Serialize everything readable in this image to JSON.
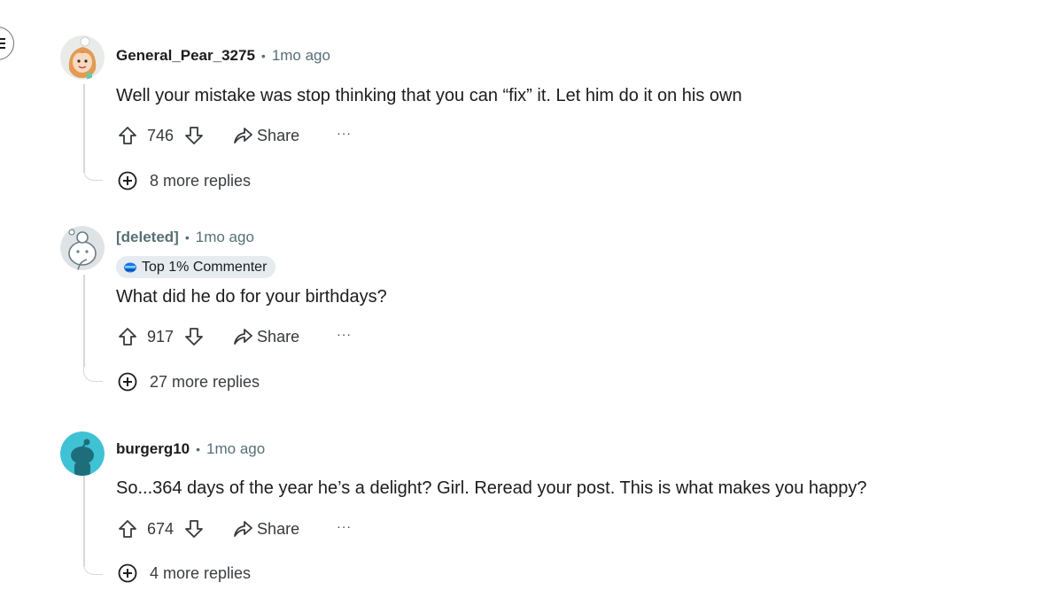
{
  "comments": [
    {
      "username": "General_Pear_3275",
      "time": "1mo ago",
      "text": "Well your mistake was stop thinking that you can “fix” it. Let him do it on his own",
      "score": "746",
      "share_label": "Share",
      "more_replies": "8 more replies",
      "avatar_icon": "snoo-avatar-girl-icon"
    },
    {
      "username": "[deleted]",
      "time": "1mo ago",
      "badge": "Top 1% Commenter",
      "text": "What did he do for your birthdays?",
      "score": "917",
      "share_label": "Share",
      "more_replies": "27 more replies",
      "avatar_icon": "snoo-avatar-deleted-icon"
    },
    {
      "username": "burgerg10",
      "time": "1mo ago",
      "text": "So...364 days of the year he’s a delight? Girl. Reread your post. This is what makes you happy?",
      "score": "674",
      "share_label": "Share",
      "more_replies": "4 more replies",
      "avatar_icon": "snoo-avatar-default-icon"
    }
  ],
  "separator": "•",
  "overflow_label": "···",
  "colors": {
    "thread_line": "#d5d8da",
    "meta_text": "#576f76",
    "badge_bg": "#e5ebee",
    "default_avatar": "#3fc2d4"
  }
}
